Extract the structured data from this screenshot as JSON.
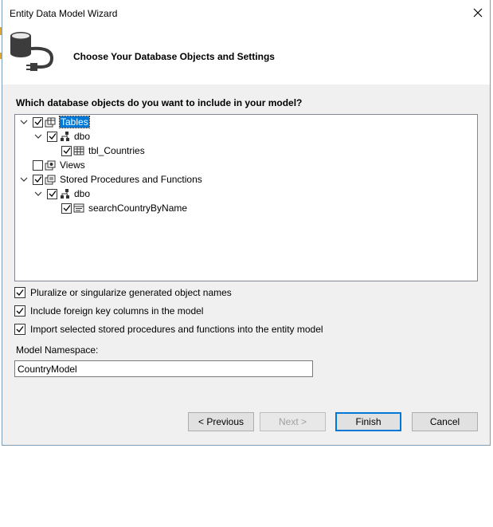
{
  "window": {
    "title": "Entity Data Model Wizard"
  },
  "header": {
    "title": "Choose Your Database Objects and Settings"
  },
  "question": "Which database objects do you want to include in your model?",
  "tree": {
    "tables": {
      "label": "Tables",
      "checked": true,
      "selected": true
    },
    "tables_dbo": {
      "label": "dbo",
      "checked": true
    },
    "tbl_countries": {
      "label": "tbl_Countries",
      "checked": true
    },
    "views": {
      "label": "Views",
      "checked": false
    },
    "procs": {
      "label": "Stored Procedures and Functions",
      "checked": true
    },
    "procs_dbo": {
      "label": "dbo",
      "checked": true
    },
    "search_proc": {
      "label": "searchCountryByName",
      "checked": true
    }
  },
  "options": {
    "pluralize": {
      "label": "Pluralize or singularize generated object names",
      "checked": true
    },
    "foreign_keys": {
      "label": "Include foreign key columns in the model",
      "checked": true
    },
    "import_procs": {
      "label": "Import selected stored procedures and functions into the entity model",
      "checked": true
    }
  },
  "namespace": {
    "label": "Model Namespace:",
    "value": "CountryModel"
  },
  "buttons": {
    "previous": "< Previous",
    "next": "Next >",
    "finish": "Finish",
    "cancel": "Cancel"
  },
  "colors": {
    "selection": "#0078d7",
    "background": "#f0f0f0",
    "border": "#7f9db9"
  }
}
